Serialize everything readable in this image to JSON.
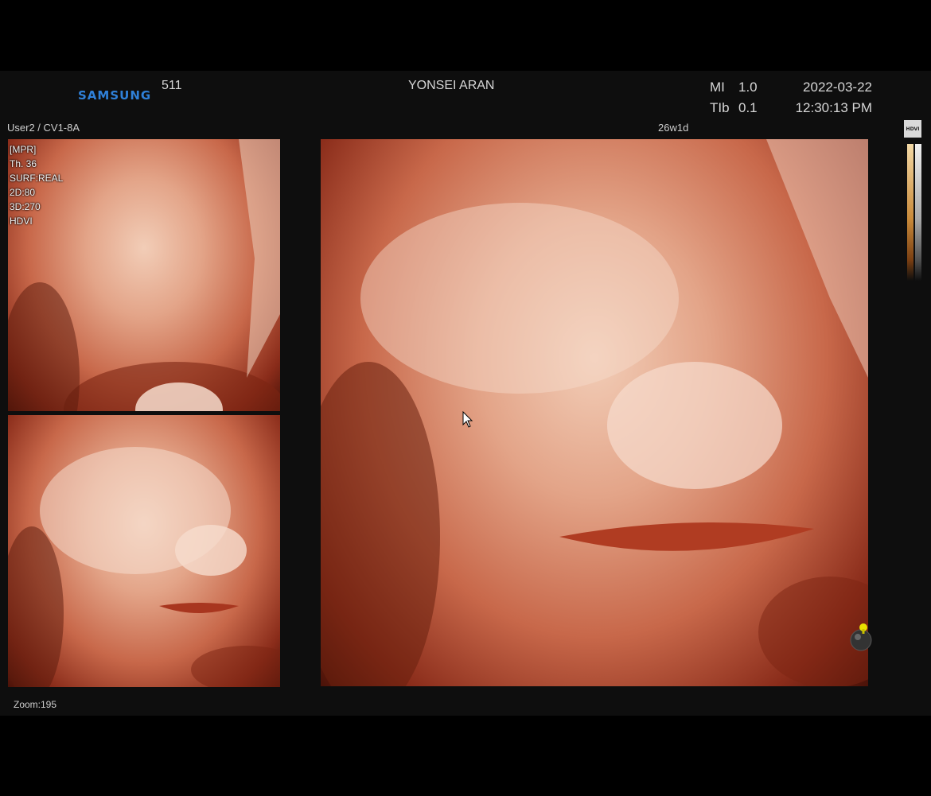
{
  "header": {
    "brand": "SAMSUNG",
    "model": "511",
    "hospital": "YONSEI ARAN",
    "mi_label": "MI",
    "mi_value": "1.0",
    "tib_label": "TIb",
    "tib_value": "0.1",
    "date": "2022-03-22",
    "time": "12:30:13 PM"
  },
  "probe": "User2 / CV1-8A",
  "gestational_age": "26w1d",
  "badge": "HDVI",
  "overlay_lines": [
    "[MPR]",
    "Th. 36",
    "SURF:REAL",
    "2D:80",
    "3D:270",
    "HDVI"
  ],
  "zoom": "Zoom:195",
  "colors": {
    "brand_blue": "#2f80d8",
    "skin_light": "#f2cdb7",
    "skin_dark": "#8a2c1a"
  }
}
